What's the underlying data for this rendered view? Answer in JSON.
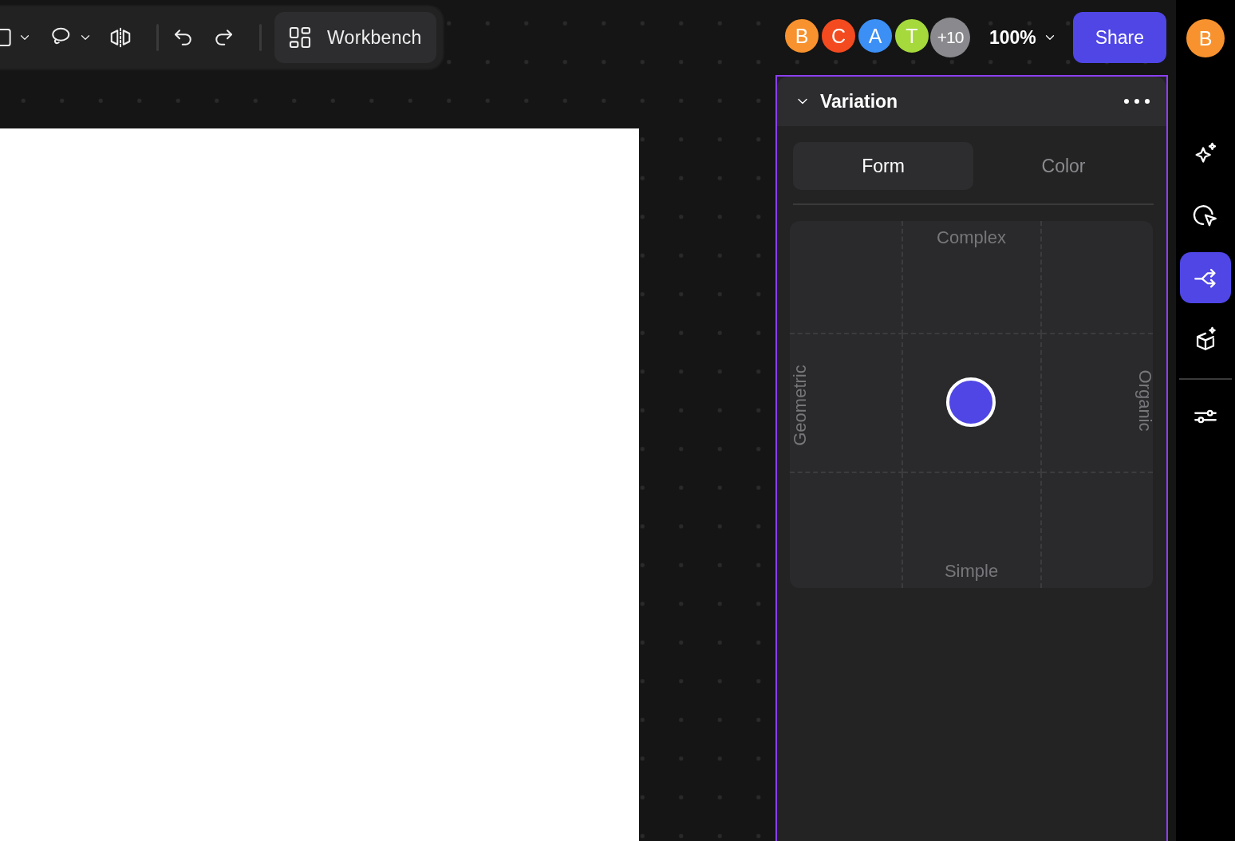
{
  "toolbar": {
    "tools": [
      {
        "kind": "rectangle",
        "dropdown": true
      },
      {
        "kind": "lasso",
        "dropdown": true
      },
      {
        "kind": "mirror",
        "dropdown": false
      },
      {
        "kind": "divider"
      },
      {
        "kind": "undo",
        "dropdown": false
      },
      {
        "kind": "redo",
        "dropdown": false
      },
      {
        "kind": "divider"
      }
    ],
    "workbench": {
      "label": "Workbench"
    }
  },
  "collaborators": [
    {
      "initial": "B",
      "color": "#f7922e"
    },
    {
      "initial": "C",
      "color": "#f44a1f"
    },
    {
      "initial": "A",
      "color": "#3b8ff5"
    },
    {
      "initial": "T",
      "color": "#a5d93c"
    },
    {
      "initial": "+10",
      "color": "#8a8a8e"
    }
  ],
  "zoom": "100%",
  "share": "Share",
  "user": {
    "initial": "B",
    "color": "#f7922e"
  },
  "panel": {
    "title": "Variation",
    "expanded": true,
    "tabs": [
      {
        "label": "Form",
        "selected": true
      },
      {
        "label": "Color",
        "selected": false
      }
    ],
    "pad": {
      "top": "Complex",
      "bottom": "Simple",
      "left": "Geometric",
      "right": "Organic"
    }
  },
  "rail": [
    {
      "kind": "sparkle",
      "selected": false
    },
    {
      "kind": "pointer",
      "selected": false
    },
    {
      "kind": "branch",
      "selected": true
    },
    {
      "kind": "cube",
      "selected": false
    },
    {
      "kind": "divider"
    },
    {
      "kind": "sliders",
      "selected": false
    }
  ]
}
